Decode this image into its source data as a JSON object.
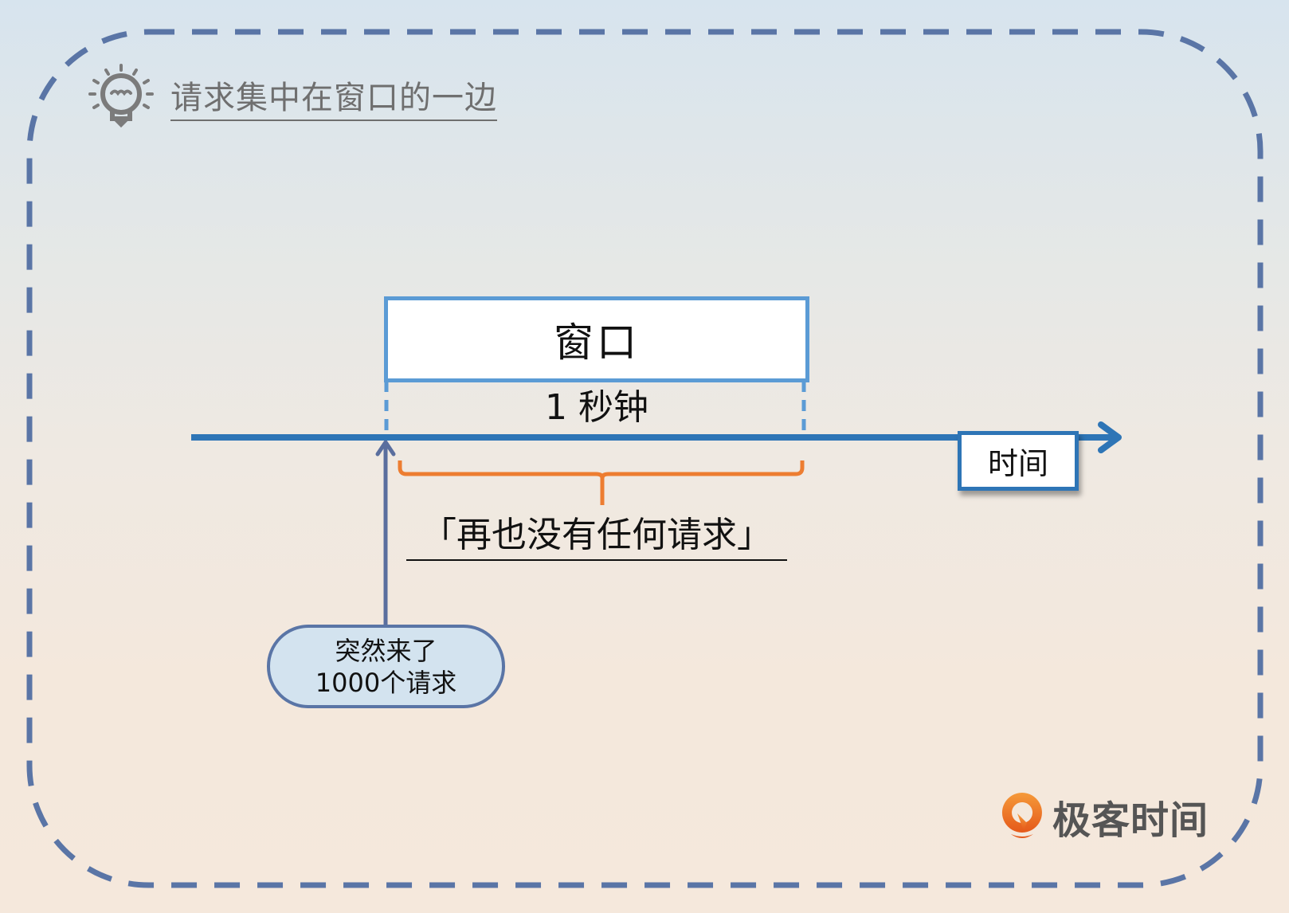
{
  "title": "请求集中在窗口的一边",
  "icons": {
    "tip": "lightbulb-icon"
  },
  "window": {
    "label": "窗口",
    "duration": "1 秒钟"
  },
  "timeline": {
    "label": "时间"
  },
  "gap_label": "「再也没有任何请求」",
  "burst": {
    "line1": "突然来了",
    "line2": "1000个请求"
  },
  "logo": {
    "text": "极客时间"
  },
  "colors": {
    "border_dash": "#5a75a6",
    "window_border": "#5b9bd5",
    "timeline": "#2e75b6",
    "bracket": "#ed7d31",
    "bubble_fill": "#d3e3ef",
    "logo_orange": "#f07a1f"
  }
}
